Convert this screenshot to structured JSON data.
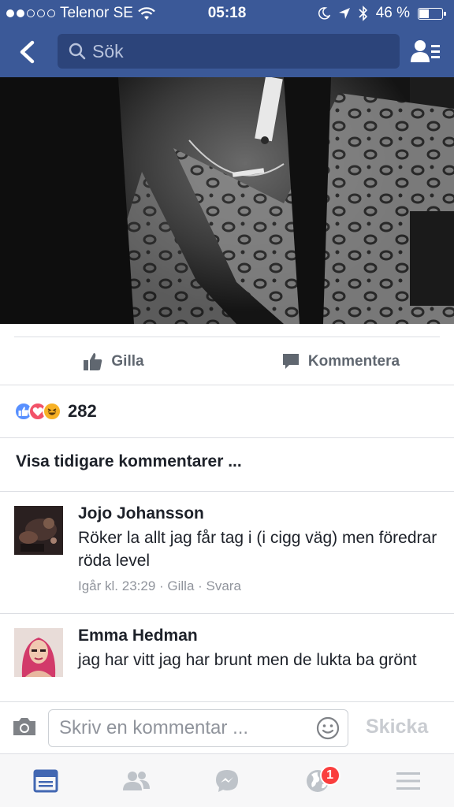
{
  "status_bar": {
    "carrier": "Telenor SE",
    "time": "05:18",
    "battery": "46 %",
    "battery_level": 0.46
  },
  "nav": {
    "search_placeholder": "Sök"
  },
  "post_actions": {
    "like_label": "Gilla",
    "comment_label": "Kommentera"
  },
  "reactions": {
    "types": [
      "like",
      "love",
      "haha"
    ],
    "count": "282"
  },
  "comments_section": {
    "show_previous": "Visa tidigare kommentarer ..."
  },
  "comments": [
    {
      "author": "Jojo Johansson",
      "text": "Röker la allt jag får tag i (i cigg väg)  men föredrar röda level",
      "time": "Igår kl. 23:29",
      "like_label": "Gilla",
      "reply_label": "Svara",
      "separator": " · "
    },
    {
      "author": "Emma Hedman",
      "text": "jag har vitt jag har brunt men de lukta ba grönt"
    }
  ],
  "composer": {
    "placeholder": "Skriv en kommentar ...",
    "send_label": "Skicka"
  },
  "tab_bar": {
    "notification_badge": "1"
  },
  "colors": {
    "brand": "#3b5998",
    "tab_active": "#4267b2",
    "tab_inactive": "#bec3c9",
    "like_reaction": "#5890ff",
    "love_reaction": "#f25268",
    "haha_reaction": "#f7b125",
    "badge": "#fa3e3e"
  }
}
